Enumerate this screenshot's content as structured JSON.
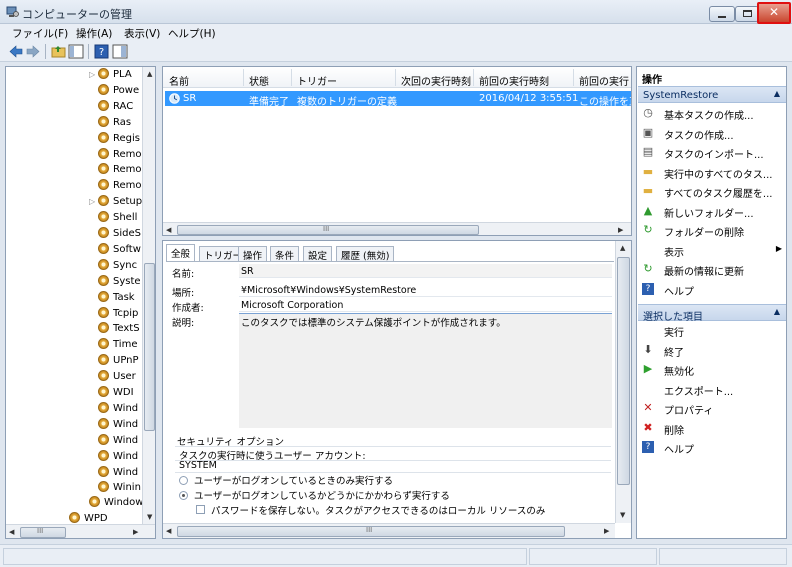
{
  "window": {
    "title": "コンピューターの管理"
  },
  "menu": [
    "ファイル(F)",
    "操作(A)",
    "表示(V)",
    "ヘルプ(H)"
  ],
  "tree": {
    "items": [
      {
        "label": "PLA",
        "expander": "▷"
      },
      {
        "label": "Powe",
        "expander": ""
      },
      {
        "label": "RAC",
        "expander": ""
      },
      {
        "label": "Ras",
        "expander": ""
      },
      {
        "label": "Regis",
        "expander": ""
      },
      {
        "label": "Remo",
        "expander": ""
      },
      {
        "label": "Remo",
        "expander": ""
      },
      {
        "label": "Remo",
        "expander": ""
      },
      {
        "label": "Setup",
        "expander": "▷"
      },
      {
        "label": "Shell",
        "expander": ""
      },
      {
        "label": "SideS",
        "expander": ""
      },
      {
        "label": "Softw",
        "expander": ""
      },
      {
        "label": "Sync",
        "expander": ""
      },
      {
        "label": "Syste",
        "expander": ""
      },
      {
        "label": "Task",
        "expander": ""
      },
      {
        "label": "Tcpip",
        "expander": ""
      },
      {
        "label": "TextS",
        "expander": ""
      },
      {
        "label": "Time",
        "expander": ""
      },
      {
        "label": "UPnP",
        "expander": ""
      },
      {
        "label": "User",
        "expander": ""
      },
      {
        "label": "WDI",
        "expander": ""
      },
      {
        "label": "Wind",
        "expander": ""
      },
      {
        "label": "Wind",
        "expander": ""
      },
      {
        "label": "Wind",
        "expander": ""
      },
      {
        "label": "Wind",
        "expander": ""
      },
      {
        "label": "Wind",
        "expander": ""
      },
      {
        "label": "Winin",
        "expander": ""
      }
    ],
    "windows_label": "Windows",
    "wpd_label": "WPD",
    "hscroll_grip": "III"
  },
  "task_list": {
    "columns": [
      "名前",
      "状態",
      "トリガー",
      "次回の実行時刻",
      "前回の実行時刻",
      "前回の実行"
    ],
    "row": {
      "name": "SR",
      "status": "準備完了",
      "trigger": "複数のトリガーの定義",
      "next_run": "",
      "last_run": "2016/04/12 3:55:51",
      "last_result": "この操作を正"
    },
    "hscroll_grip": "III"
  },
  "detail": {
    "tabs": [
      "全般",
      "トリガー",
      "操作",
      "条件",
      "設定",
      "履歴 (無効)"
    ],
    "name_label": "名前:",
    "name_value": "SR",
    "location_label": "場所:",
    "location_value": "¥Microsoft¥Windows¥SystemRestore",
    "author_label": "作成者:",
    "author_value": "Microsoft Corporation",
    "desc_label": "説明:",
    "desc_value": "このタスクでは標準のシステム保護ポイントが作成されます。",
    "security_title": "セキュリティ オプション",
    "run_as_label": "タスクの実行時に使うユーザー アカウント:",
    "run_as_value": "SYSTEM",
    "opt1": "ユーザーがログオンしているときのみ実行する",
    "opt2": "ユーザーがログオンしているかどうかにかかわらず実行する",
    "opt3": "パスワードを保存しない。タスクがアクセスできるのはローカル リソースのみ",
    "hscroll_grip": "III"
  },
  "actions": {
    "title": "操作",
    "section1": "SystemRestore",
    "items1": [
      {
        "label": "基本タスクの作成...",
        "icon": "basic-task-icon",
        "glyph": "◷"
      },
      {
        "label": "タスクの作成...",
        "icon": "create-task-icon",
        "glyph": "▣"
      },
      {
        "label": "タスクのインポート...",
        "icon": "import-icon",
        "glyph": "▤"
      },
      {
        "label": "実行中のすべてのタス...",
        "icon": "running-tasks-icon",
        "glyph": "▬"
      },
      {
        "label": "すべてのタスク履歴を...",
        "icon": "history-folder-icon",
        "glyph": "▬"
      },
      {
        "label": "新しいフォルダー...",
        "icon": "new-folder-icon",
        "glyph": "▲"
      },
      {
        "label": "フォルダーの削除",
        "icon": "delete-folder-icon",
        "glyph": "↻"
      },
      {
        "label": "表示",
        "icon": "",
        "glyph": "",
        "sub": "▶"
      },
      {
        "label": "最新の情報に更新",
        "icon": "refresh-icon",
        "glyph": "↻"
      },
      {
        "label": "ヘルプ",
        "icon": "help-icon",
        "glyph": "?"
      }
    ],
    "section2": "選択した項目",
    "items2": [
      {
        "label": "実行",
        "icon": "",
        "glyph": ""
      },
      {
        "label": "終了",
        "icon": "stop-icon",
        "glyph": "⬇"
      },
      {
        "label": "無効化",
        "icon": "disable-icon",
        "glyph": "▶"
      },
      {
        "label": "エクスポート...",
        "icon": "",
        "glyph": ""
      },
      {
        "label": "プロパティ",
        "icon": "properties-icon",
        "glyph": "✕"
      },
      {
        "label": "削除",
        "icon": "delete-icon",
        "glyph": "✖"
      },
      {
        "label": "ヘルプ",
        "icon": "help-icon",
        "glyph": "?"
      }
    ]
  },
  "colors": {
    "selection": "#3399ff",
    "close_highlight": "#e01010",
    "section_text": "#0b2e62"
  }
}
